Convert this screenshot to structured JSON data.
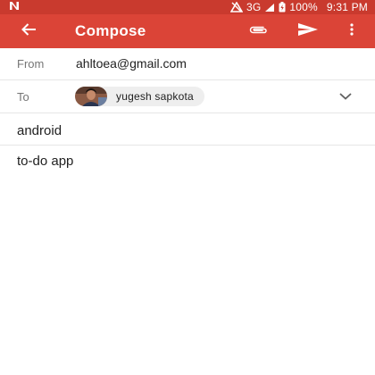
{
  "status_bar": {
    "network": "3G",
    "battery": "100%",
    "time": "9:31 PM",
    "icons": [
      "notification-n-icon",
      "signal-off-icon",
      "cell-signal-icon",
      "battery-charging-icon"
    ]
  },
  "app_bar": {
    "title": "Compose",
    "icons": {
      "back": "arrow-back-icon",
      "attach": "paperclip-icon",
      "send": "send-icon",
      "more": "more-vert-icon"
    },
    "colors": {
      "status": "#c93a2e",
      "toolbar": "#db4437",
      "text": "#ffffff"
    }
  },
  "compose": {
    "from": {
      "label": "From",
      "value": "ahltoea@gmail.com"
    },
    "to": {
      "label": "To",
      "recipients": [
        {
          "name": "yugesh sapkota",
          "avatar": "avatar-photo"
        }
      ]
    },
    "subject": {
      "value": "android"
    },
    "body": {
      "value": "to-do app"
    }
  }
}
